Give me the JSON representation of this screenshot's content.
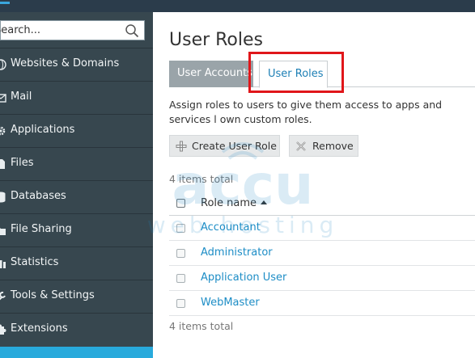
{
  "sidebar": {
    "search": {
      "placeholder": "Search..."
    },
    "items": [
      {
        "label": "Websites & Domains",
        "icon": "globe-icon"
      },
      {
        "label": "Mail",
        "icon": "envelope-icon"
      },
      {
        "label": "Applications",
        "icon": "gear-icon"
      },
      {
        "label": "Files",
        "icon": "file-icon"
      },
      {
        "label": "Databases",
        "icon": "database-icon"
      },
      {
        "label": "File Sharing",
        "icon": "share-icon"
      },
      {
        "label": "Statistics",
        "icon": "bar-chart-icon"
      },
      {
        "label": "Tools & Settings",
        "icon": "wrench-icon"
      },
      {
        "label": "Extensions",
        "icon": "puzzle-icon"
      }
    ]
  },
  "main": {
    "title": "User Roles",
    "tabs": [
      {
        "label": "User Accounts",
        "active": false
      },
      {
        "label": "User Roles",
        "active": true
      }
    ],
    "description": "Assign roles to users to give them access to apps and services l own custom roles.",
    "buttons": {
      "create": "Create User Role",
      "remove": "Remove"
    },
    "items_total_top": "4 items total",
    "items_total_bottom": "4 items total",
    "table": {
      "header": "Role name",
      "rows": [
        "Accountant",
        "Administrator",
        "Application User",
        "WebMaster"
      ]
    }
  },
  "watermark": {
    "line1": "accu",
    "line2": "web hosting"
  },
  "colors": {
    "sidebar_bg": "#37474f",
    "topbar_bg": "#2b3c4b",
    "link": "#1d8dc6",
    "highlight": "#e0161a",
    "accent": "#28aadc"
  }
}
